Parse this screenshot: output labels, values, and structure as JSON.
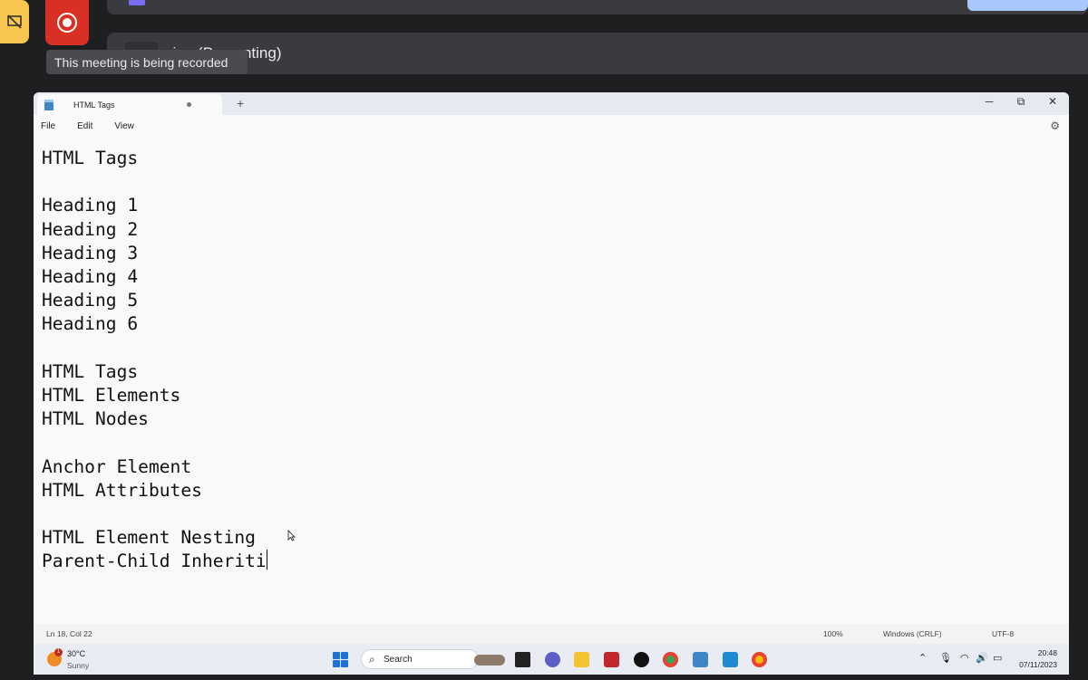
{
  "meet": {
    "recording_tooltip": "This meeting is being recorded",
    "presenting_title": "sign (Presenting)"
  },
  "window": {
    "tab_title": "HTML Tags",
    "new_tab": "+",
    "minimize": "─",
    "restore": "⧉",
    "close": "✕",
    "menu": [
      "File",
      "Edit",
      "View"
    ]
  },
  "editor": {
    "lines": [
      "HTML Tags",
      "",
      "Heading 1",
      "Heading 2",
      "Heading 3",
      "Heading 4",
      "Heading 5",
      "Heading 6",
      "",
      "HTML Tags",
      "HTML Elements",
      "HTML Nodes",
      "",
      "Anchor Element",
      "HTML Attributes",
      "",
      "HTML Element Nesting",
      "Parent-Child Inheriti"
    ]
  },
  "statusbar": {
    "position": "Ln 18, Col 22",
    "zoom": "100%",
    "line_ending": "Windows (CRLF)",
    "encoding": "UTF-8"
  },
  "taskbar": {
    "weather_temp": "30°C",
    "weather_condition": "Sunny",
    "weather_badge": "1",
    "search_label": "Search",
    "time": "20:48",
    "date": "07/11/2023"
  },
  "colors": {
    "record_red": "#d93025",
    "meet_panel": "#3a3b3e",
    "taskbar": "#e9edf3"
  }
}
